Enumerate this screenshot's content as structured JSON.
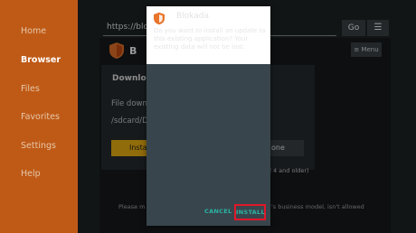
{
  "sidebar": {
    "items": [
      {
        "label": "Home",
        "active": false
      },
      {
        "label": "Browser",
        "active": true
      },
      {
        "label": "Files",
        "active": false
      },
      {
        "label": "Favorites",
        "active": false
      },
      {
        "label": "Settings",
        "active": false
      },
      {
        "label": "Help",
        "active": false
      }
    ]
  },
  "topbar": {
    "url": "https://blok",
    "go_label": "Go",
    "menu_icon": "hamburger-icon"
  },
  "webpage": {
    "logo_text": "B L",
    "menu_label": "≡ Menu",
    "card_title": "Downloa",
    "card_text": "File downl",
    "card_path": "/sdcard/D",
    "install_label": "Insta",
    "done_label": "one",
    "note": "oid 4 and older)",
    "footer_left": "Please m",
    "footer_right": "'s business model, isn't allowed"
  },
  "installer": {
    "app_name": "Blokada",
    "question": "Do you want to install an update to this existing application? Your existing data will not be lost.",
    "cancel_label": "CANCEL",
    "install_label": "INSTALL"
  },
  "colors": {
    "sidebar": "#bf5a16",
    "accent_teal": "#2bb5a6",
    "highlight_red": "#e0182a",
    "yellow_button": "#f0b413"
  }
}
